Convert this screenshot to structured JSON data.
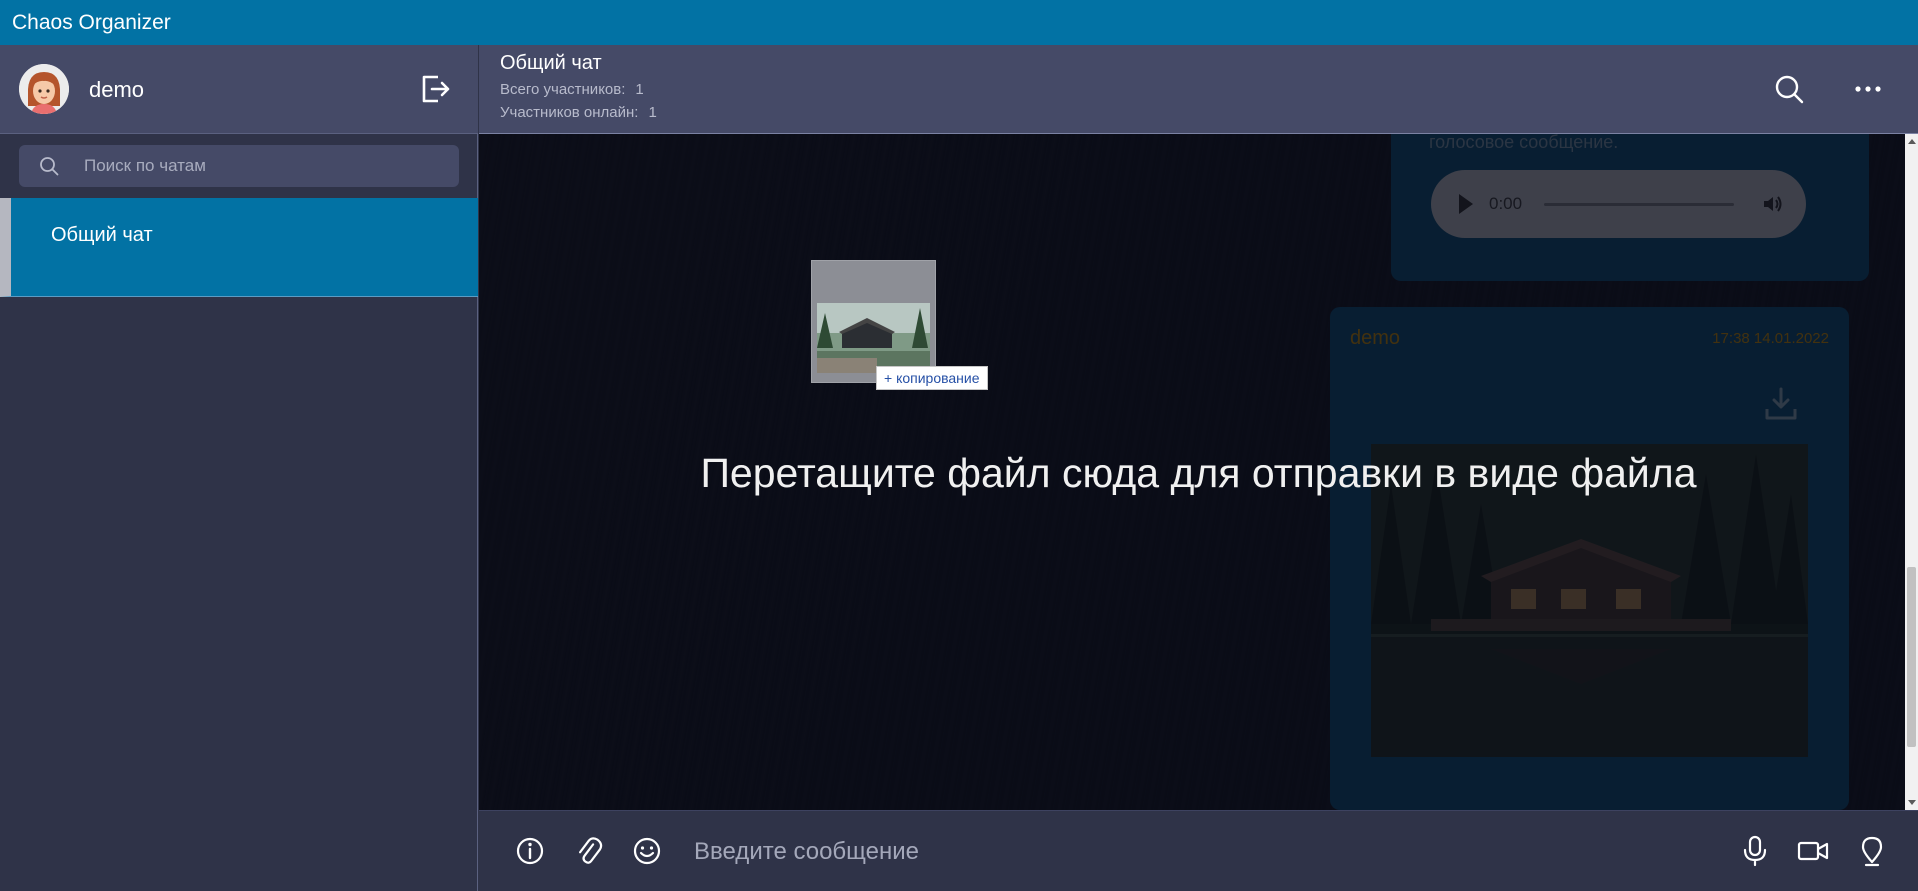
{
  "app": {
    "title": "Chaos Organizer"
  },
  "sidebar": {
    "user": {
      "name": "demo",
      "avatar": "avatar-female-icon"
    },
    "logout_icon": "logout-icon",
    "search": {
      "placeholder": "Поиск по чатам",
      "value": ""
    },
    "chats": [
      {
        "name": "Общий чат",
        "active": true
      }
    ]
  },
  "chat": {
    "title": "Общий чат",
    "total_label": "Всего участников:",
    "total_value": "1",
    "online_label": "Участников онлайн:",
    "online_value": "1",
    "header_icons": [
      "search-icon",
      "more-dots-icon"
    ]
  },
  "messages": [
    {
      "type": "audio",
      "partial_text": "голосовое сообщение.",
      "audio_time": "0:00"
    },
    {
      "type": "image",
      "sender": "demo",
      "timestamp": "17:38 14.01.2022",
      "icon": "download-icon"
    }
  ],
  "drag": {
    "drop_hint": "Перетащите файл сюда для отправки в виде файла",
    "copy_label": "копирование",
    "copy_icon": "plus-icon"
  },
  "composer": {
    "placeholder": "Введите сообщение",
    "value": "",
    "icons": [
      "info-icon",
      "paperclip-icon",
      "smile-icon",
      "microphone-icon",
      "video-camera-icon",
      "location-pin-icon"
    ]
  },
  "colors": {
    "titlebar": "#0272a4",
    "panel": "#454a67",
    "sidebar": "#2f3348",
    "bubble": "#0a5a86",
    "sender_accent": "#e8a300"
  }
}
